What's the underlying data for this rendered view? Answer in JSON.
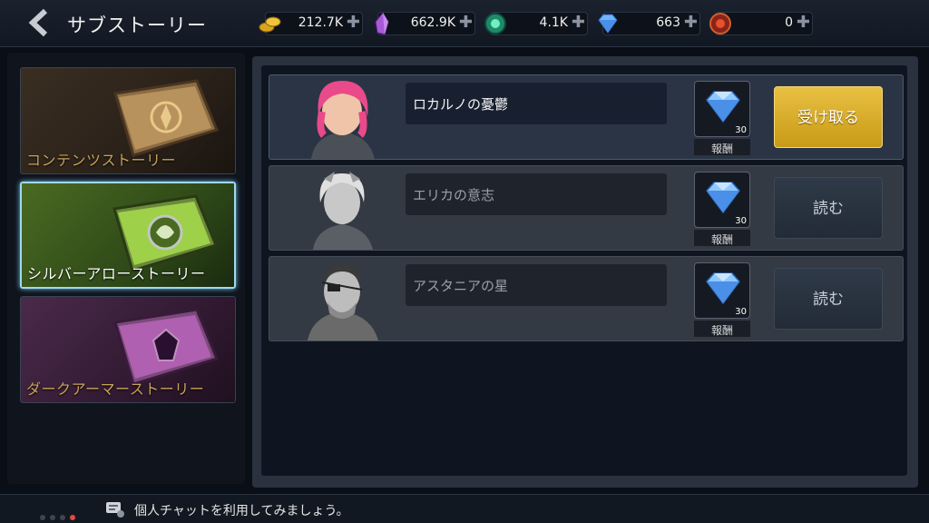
{
  "header": {
    "title": "サブストーリー",
    "back_icon": "chevron-left-icon"
  },
  "currencies": [
    {
      "name": "gold",
      "icon": "gold-coins-icon",
      "value": "212.7K"
    },
    {
      "name": "crystal",
      "icon": "purple-crystal-icon",
      "value": "662.9K"
    },
    {
      "name": "orb",
      "icon": "green-orb-icon",
      "value": "4.1K"
    },
    {
      "name": "diamond",
      "icon": "diamond-icon",
      "value": "663"
    },
    {
      "name": "ruby",
      "icon": "red-gem-icon",
      "value": "0"
    }
  ],
  "categories": [
    {
      "label": "コンテンツストーリー",
      "selected": false,
      "color": "#8a6a3a"
    },
    {
      "label": "シルバーアローストーリー",
      "selected": true,
      "color": "#7dbf3a"
    },
    {
      "label": "ダークアーマーストーリー",
      "selected": false,
      "color": "#9a4a9a"
    }
  ],
  "stories": [
    {
      "title": "ロカルノの憂鬱",
      "reward_qty": "30",
      "reward_label": "報酬",
      "action": "受け取る",
      "active": true
    },
    {
      "title": "エリカの意志",
      "reward_qty": "30",
      "reward_label": "報酬",
      "action": "読む",
      "active": false
    },
    {
      "title": "アスタニアの星",
      "reward_qty": "30",
      "reward_label": "報酬",
      "action": "読む",
      "active": false
    }
  ],
  "footer": {
    "chat_message": "個人チャットを利用してみましょう。"
  },
  "colors": {
    "accent_gold": "#d9ac2a",
    "selection": "#9fd8f0"
  }
}
